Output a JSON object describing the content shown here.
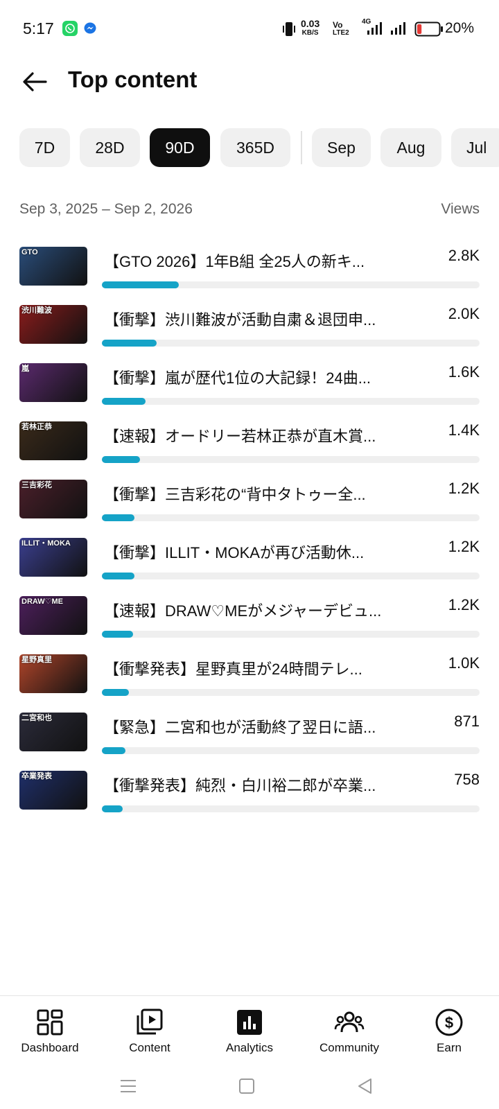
{
  "status_bar": {
    "time": "5:17",
    "net_speed_value": "0.03",
    "net_speed_unit": "KB/S",
    "volte_top": "Vo",
    "volte_bottom": "LTE2",
    "network_type": "4G",
    "battery_percent": "20%",
    "battery_level": 0.2,
    "battery_color": "#e53935"
  },
  "header": {
    "title": "Top content"
  },
  "chips": [
    {
      "label": "7D",
      "active": false
    },
    {
      "label": "28D",
      "active": false
    },
    {
      "label": "90D",
      "active": true
    },
    {
      "label": "365D",
      "active": false
    },
    {
      "label": "Sep",
      "active": false
    },
    {
      "label": "Aug",
      "active": false
    },
    {
      "label": "Jul",
      "active": false
    }
  ],
  "range": {
    "text": "Sep 3, 2025 – Sep 2, 2026",
    "views_label": "Views"
  },
  "accent_color": "#15a3c7",
  "videos": [
    {
      "title": "【GTO 2026】1年B組 全25人の新キ...",
      "views": "2.8K",
      "views_num": 2800,
      "thumb_text": "GTO",
      "thumb_color": "#2a4d7a"
    },
    {
      "title": "【衝撃】渋川難波が活動自粛＆退団申...",
      "views": "2.0K",
      "views_num": 2000,
      "thumb_text": "渋川難波",
      "thumb_color": "#8a1c1c"
    },
    {
      "title": "【衝撃】嵐が歴代1位の大記録！24曲...",
      "views": "1.6K",
      "views_num": 1600,
      "thumb_text": "嵐",
      "thumb_color": "#5b2a6e"
    },
    {
      "title": "【速報】オードリー若林正恭が直木賞...",
      "views": "1.4K",
      "views_num": 1400,
      "thumb_text": "若林正恭",
      "thumb_color": "#3a2a1a"
    },
    {
      "title": "【衝撃】三吉彩花の“背中タトゥー全...",
      "views": "1.2K",
      "views_num": 1200,
      "thumb_text": "三吉彩花",
      "thumb_color": "#4a1f2a"
    },
    {
      "title": "【衝撃】ILLIT・MOKAが再び活動休...",
      "views": "1.2K",
      "views_num": 1200,
      "thumb_text": "ILLIT・MOKA",
      "thumb_color": "#3b3f8f"
    },
    {
      "title": "【速報】DRAW♡MEがメジャーデビュ...",
      "views": "1.2K",
      "views_num": 1150,
      "thumb_text": "DRAW♡ME",
      "thumb_color": "#4d1f5c"
    },
    {
      "title": "【衝撃発表】星野真里が24時間テレ...",
      "views": "1.0K",
      "views_num": 1000,
      "thumb_text": "星野真里",
      "thumb_color": "#b0452a"
    },
    {
      "title": "【緊急】二宮和也が活動終了翌日に語...",
      "views": "871",
      "views_num": 871,
      "thumb_text": "二宮和也",
      "thumb_color": "#2b2b3a"
    },
    {
      "title": "【衝撃発表】純烈・白川裕二郎が卒業...",
      "views": "758",
      "views_num": 758,
      "thumb_text": "卒業発表",
      "thumb_color": "#1f2f6a"
    }
  ],
  "bar_max": 13800,
  "bottom_nav": [
    {
      "label": "Dashboard",
      "icon": "dashboard-icon",
      "active": false
    },
    {
      "label": "Content",
      "icon": "content-icon",
      "active": false
    },
    {
      "label": "Analytics",
      "icon": "analytics-icon",
      "active": true
    },
    {
      "label": "Community",
      "icon": "community-icon",
      "active": false
    },
    {
      "label": "Earn",
      "icon": "earn-icon",
      "active": false
    }
  ],
  "system_nav": [
    "menu-icon",
    "home-icon",
    "back-triangle-icon"
  ]
}
